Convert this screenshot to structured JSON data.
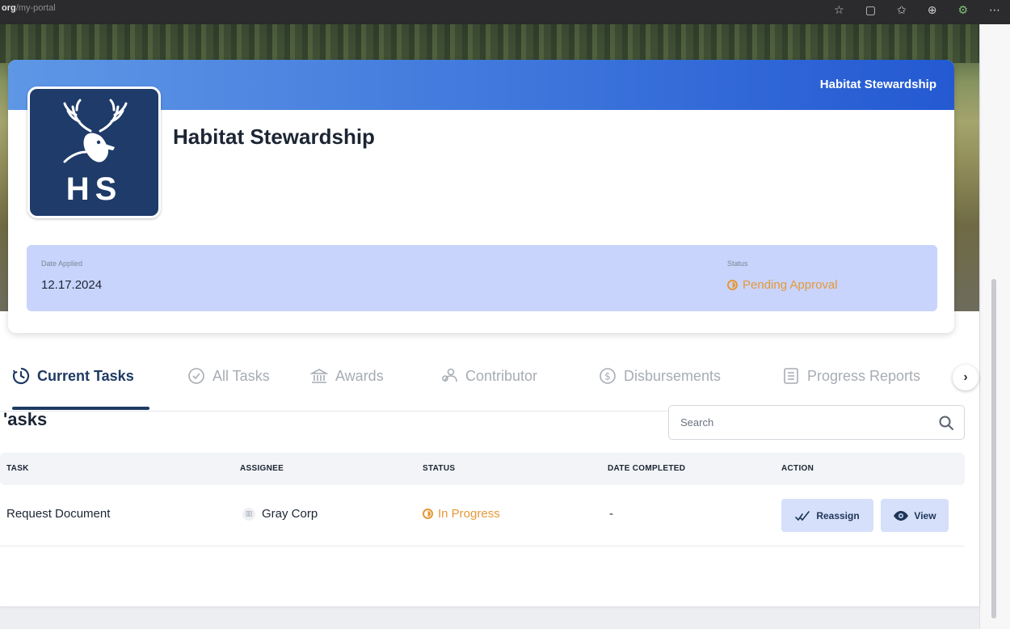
{
  "browser": {
    "url_domain": "org",
    "url_path": "/my-portal",
    "icons": [
      "star-icon",
      "reader-mode-icon",
      "favorites-icon",
      "collections-icon",
      "extension-icon",
      "more-icon"
    ]
  },
  "project": {
    "band_title": "Habitat Stewardship",
    "title": "Habitat Stewardship",
    "logo_text": "HS",
    "date_label": "Date Applied",
    "date_value": "12.17.2024",
    "status_label": "Status",
    "status_value": "Pending Approval",
    "status_color": "#e49838"
  },
  "tabs": [
    {
      "label": "Current Tasks",
      "icon": "clock-icon",
      "active": true
    },
    {
      "label": "All Tasks",
      "icon": "check-circle-icon",
      "active": false
    },
    {
      "label": "Awards",
      "icon": "bank-icon",
      "active": false
    },
    {
      "label": "Contributor",
      "icon": "people-icon",
      "active": false
    },
    {
      "label": "Disbursements",
      "icon": "dollar-circle-icon",
      "active": false
    },
    {
      "label": "Progress Reports",
      "icon": "list-doc-icon",
      "active": false
    }
  ],
  "tasks": {
    "title": "'asks",
    "search_placeholder": "Search",
    "columns": [
      "TASK",
      "ASSIGNEE",
      "STATUS",
      "DATE COMPLETED",
      "ACTION"
    ],
    "rows": [
      {
        "task": "Request Document",
        "assignee": "Gray Corp",
        "status": "In Progress",
        "date_completed": "-",
        "actions": [
          "Reassign",
          "View"
        ]
      }
    ]
  },
  "colors": {
    "accent_blue": "#3e76dc",
    "navy": "#1f3a63",
    "pending_orange": "#e49838",
    "info_panel": "#c8d4fb",
    "button_bg": "#d6e0fb"
  }
}
